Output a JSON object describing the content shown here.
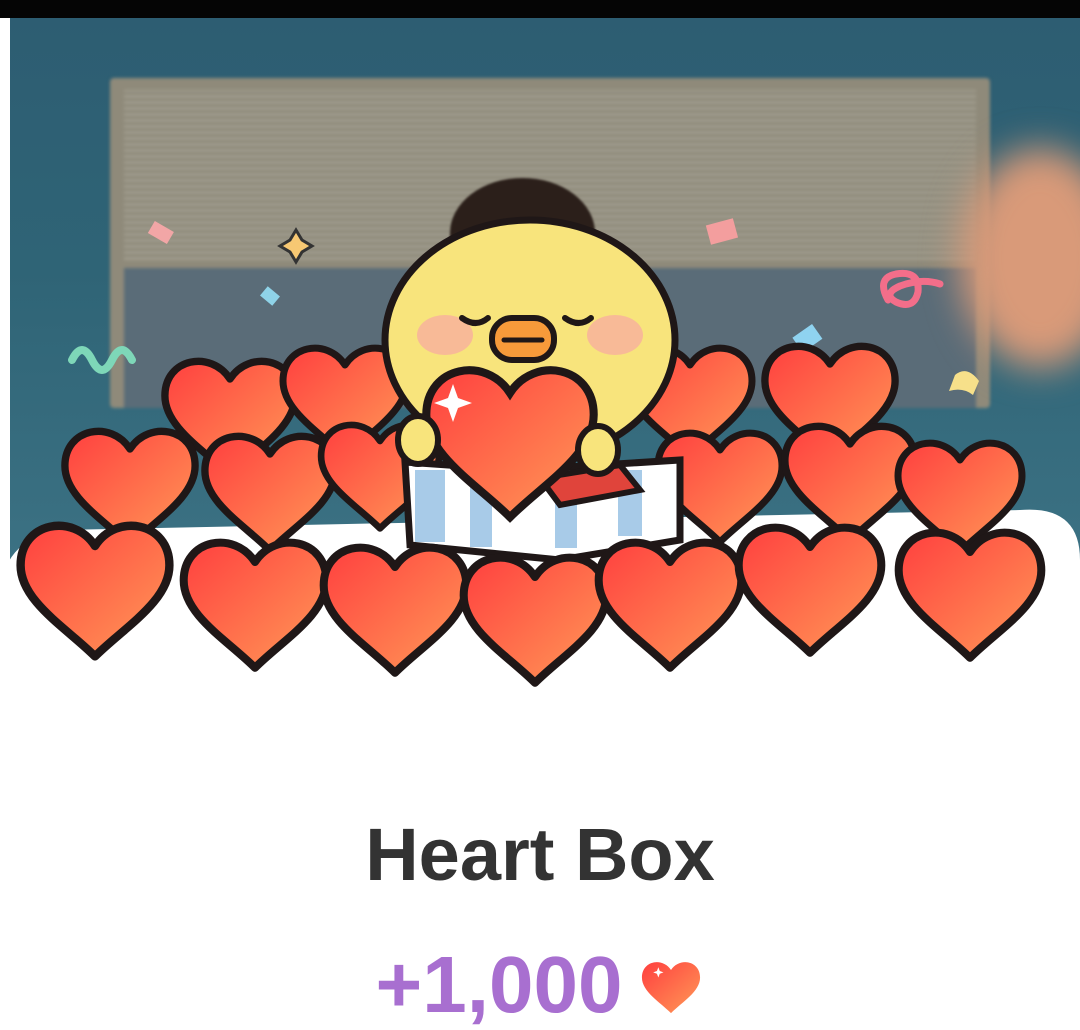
{
  "reward": {
    "title": "Heart Box",
    "amount": "+1,000"
  },
  "icons": {
    "currency": "heart-icon",
    "mascot": "chick-mascot"
  },
  "colors": {
    "heart_fill_top": "#ff4d3d",
    "heart_fill_bottom": "#ff9a58",
    "amount": "#a86fd0",
    "title": "#333333"
  }
}
